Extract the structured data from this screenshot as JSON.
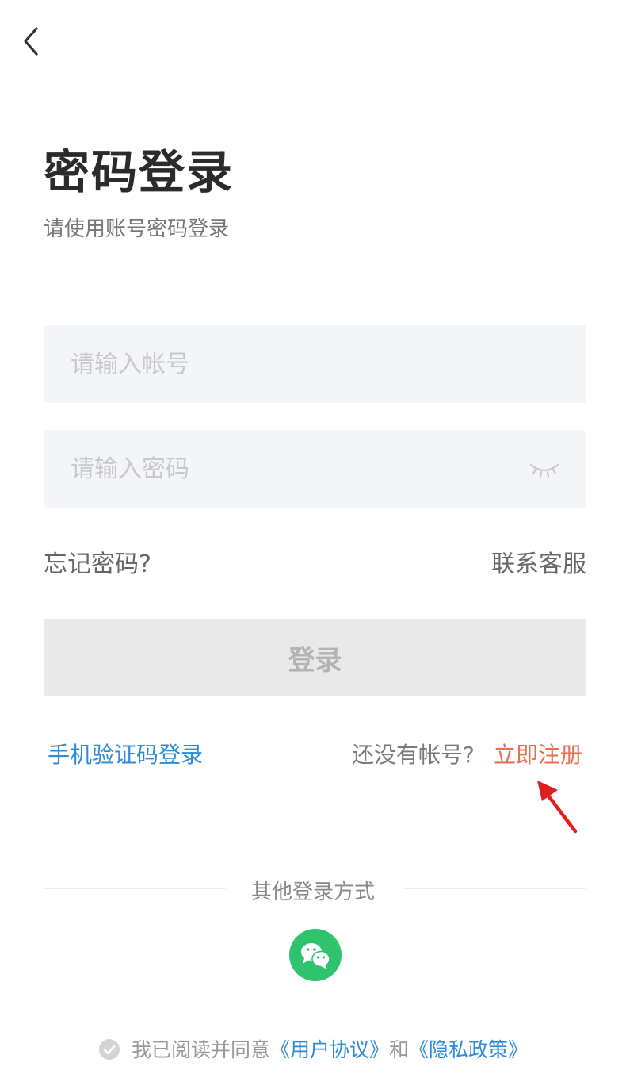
{
  "header": {
    "back_icon": "chevron-left-icon"
  },
  "title": "密码登录",
  "subtitle": "请使用账号密码登录",
  "account_field": {
    "placeholder": "请输入帐号",
    "value": ""
  },
  "password_field": {
    "placeholder": "请输入密码",
    "value": "",
    "toggle_icon": "eye-closed-icon"
  },
  "links": {
    "forgot_password": "忘记密码?",
    "contact_service": "联系客服"
  },
  "login_button": "登录",
  "sms_login": "手机验证码登录",
  "no_account_text": "还没有帐号?",
  "register_link": "立即注册",
  "other_login": {
    "label": "其他登录方式",
    "wechat_icon": "wechat-icon"
  },
  "agreement": {
    "check_icon": "check-circle-icon",
    "prefix": "我已阅读并同意",
    "user_agreement": "《用户协议》",
    "and": "和",
    "privacy_policy": "《隐私政策》"
  },
  "colors": {
    "link_blue": "#2d8bd8",
    "register_orange": "#e86f50",
    "wechat_green": "#2fc36e",
    "annotation_red": "#e02020",
    "input_bg": "#f4f5f7",
    "button_disabled_bg": "#e9e9e9"
  }
}
